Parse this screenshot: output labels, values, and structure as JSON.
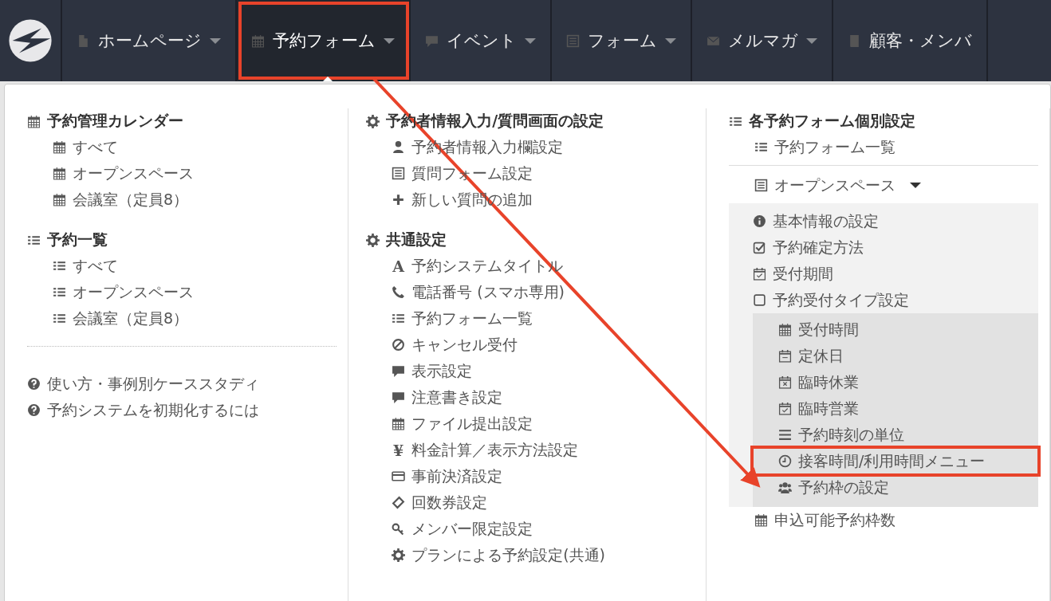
{
  "nav": {
    "items": [
      {
        "label": "ホームページ",
        "selected": false,
        "highlighted": false
      },
      {
        "label": "予約フォーム",
        "selected": true,
        "highlighted": true
      },
      {
        "label": "イベント",
        "selected": false,
        "highlighted": false
      },
      {
        "label": "フォーム",
        "selected": false,
        "highlighted": false
      },
      {
        "label": "メルマガ",
        "selected": false,
        "highlighted": false
      },
      {
        "label": "顧客・メンバ",
        "selected": false,
        "highlighted": false
      }
    ]
  },
  "menu": {
    "column_1": {
      "sections": [
        {
          "heading": "予約管理カレンダー",
          "items": [
            "すべて",
            "オープンスペース",
            "会議室（定員8）"
          ]
        },
        {
          "heading": "予約一覧",
          "items": [
            "すべて",
            "オープンスペース",
            "会議室（定員8）"
          ]
        }
      ],
      "help_links": [
        "使い方・事例別ケーススタディ",
        "予約システムを初期化するには"
      ]
    },
    "column_2": {
      "sections": [
        {
          "heading": "予約者情報入力/質問画面の設定",
          "items": [
            {
              "label": "予約者情報入力欄設定"
            },
            {
              "label": "質問フォーム設定"
            },
            {
              "label": "新しい質問の追加"
            }
          ]
        },
        {
          "heading": "共通設定",
          "items": [
            {
              "label": "予約システムタイトル",
              "glyph": "A"
            },
            {
              "label": "電話番号 (スマホ専用)"
            },
            {
              "label": "予約フォーム一覧"
            },
            {
              "label": "キャンセル受付"
            },
            {
              "label": "表示設定"
            },
            {
              "label": "注意書き設定"
            },
            {
              "label": "ファイル提出設定"
            },
            {
              "label": "料金計算／表示方法設定",
              "glyph": "¥"
            },
            {
              "label": "事前決済設定"
            },
            {
              "label": "回数券設定"
            },
            {
              "label": "メンバー限定設定"
            },
            {
              "label": "プランによる予約設定(共通)"
            }
          ]
        }
      ]
    },
    "column_3": {
      "heading": "各予約フォーム個別設定",
      "list_link": "予約フォーム一覧",
      "form": {
        "label": "オープンスペース",
        "expanded": true,
        "items": [
          "基本情報の設定",
          "予約確定方法",
          "受付期間",
          "予約受付タイプ設定"
        ],
        "sub_items": [
          {
            "label": "受付時間",
            "highlighted": false
          },
          {
            "label": "定休日",
            "highlighted": false
          },
          {
            "label": "臨時休業",
            "highlighted": false
          },
          {
            "label": "臨時営業",
            "highlighted": false
          },
          {
            "label": "予約時刻の単位",
            "highlighted": false
          },
          {
            "label": "接客時間/利用時間メニュー",
            "highlighted": true
          },
          {
            "label": "予約枠の設定",
            "highlighted": false
          }
        ],
        "after": [
          "申込可能予約枠数"
        ]
      }
    }
  }
}
